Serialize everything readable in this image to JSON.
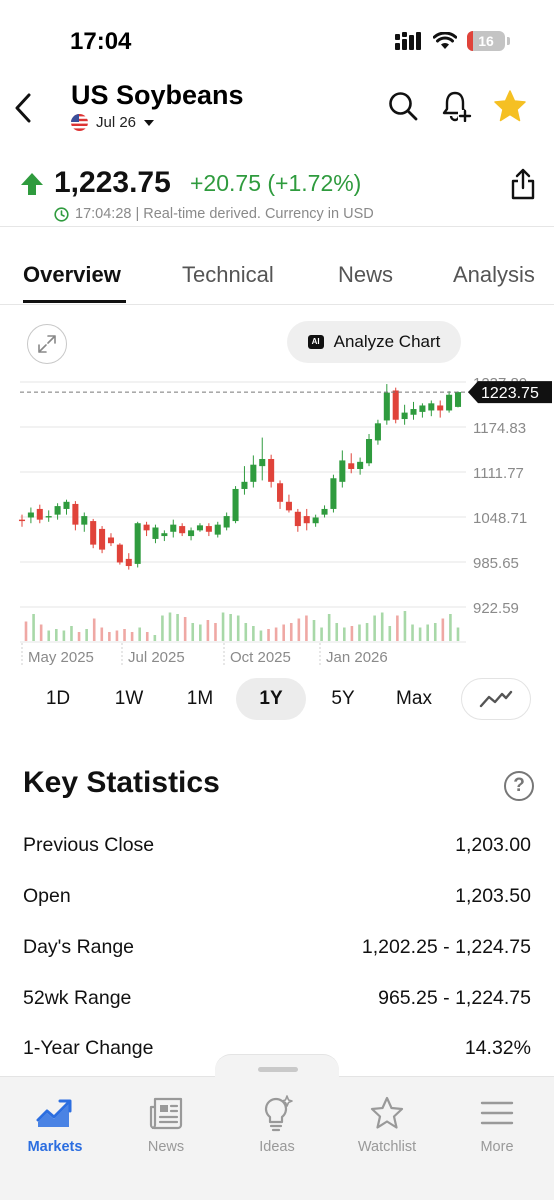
{
  "status_bar": {
    "time": "17:04",
    "battery": "16"
  },
  "header": {
    "title": "US Soybeans",
    "contract": "Jul 26",
    "icons": [
      "back-icon",
      "search-icon",
      "bell-plus-icon",
      "star-icon"
    ]
  },
  "quote": {
    "price": "1,223.75",
    "change": "+20.75 (+1.72%)",
    "timestamp": "17:04:28 | Real-time derived. Currency in USD",
    "up_color": "#2f9b3e",
    "down_color": "#e0433a"
  },
  "tabs": [
    "Overview",
    "Technical",
    "News",
    "Analysis"
  ],
  "active_tab": "Overview",
  "chart_controls": {
    "analyze_label": "Analyze Chart",
    "ai_badge": "AI"
  },
  "chart_data": {
    "type": "candlestick",
    "x_tick_labels": [
      "May 2025",
      "Jul 2025",
      "Oct 2025",
      "Jan 2026"
    ],
    "y_tick_labels": [
      "1237.89",
      "1174.83",
      "1111.77",
      "1048.71",
      "985.65",
      "922.59"
    ],
    "ylim": [
      922.59,
      1237.89
    ],
    "last_price_label": "1223.75",
    "candles": [
      {
        "o": 1045,
        "h": 1052,
        "l": 1035,
        "c": 1043
      },
      {
        "o": 1048,
        "h": 1062,
        "l": 1040,
        "c": 1055
      },
      {
        "o": 1060,
        "h": 1066,
        "l": 1040,
        "c": 1045
      },
      {
        "o": 1048,
        "h": 1058,
        "l": 1042,
        "c": 1050
      },
      {
        "o": 1052,
        "h": 1068,
        "l": 1045,
        "c": 1064
      },
      {
        "o": 1060,
        "h": 1073,
        "l": 1052,
        "c": 1070
      },
      {
        "o": 1067,
        "h": 1071,
        "l": 1030,
        "c": 1038
      },
      {
        "o": 1038,
        "h": 1055,
        "l": 1028,
        "c": 1050
      },
      {
        "o": 1043,
        "h": 1046,
        "l": 1005,
        "c": 1010
      },
      {
        "o": 1032,
        "h": 1036,
        "l": 998,
        "c": 1003
      },
      {
        "o": 1020,
        "h": 1026,
        "l": 1008,
        "c": 1012
      },
      {
        "o": 1010,
        "h": 1012,
        "l": 982,
        "c": 985
      },
      {
        "o": 990,
        "h": 998,
        "l": 975,
        "c": 980
      },
      {
        "o": 983,
        "h": 1042,
        "l": 978,
        "c": 1040
      },
      {
        "o": 1038,
        "h": 1042,
        "l": 1022,
        "c": 1030
      },
      {
        "o": 1018,
        "h": 1038,
        "l": 1012,
        "c": 1034
      },
      {
        "o": 1022,
        "h": 1030,
        "l": 1015,
        "c": 1026
      },
      {
        "o": 1028,
        "h": 1045,
        "l": 1020,
        "c": 1038
      },
      {
        "o": 1036,
        "h": 1040,
        "l": 1022,
        "c": 1026
      },
      {
        "o": 1022,
        "h": 1034,
        "l": 1016,
        "c": 1030
      },
      {
        "o": 1030,
        "h": 1040,
        "l": 1028,
        "c": 1037
      },
      {
        "o": 1036,
        "h": 1040,
        "l": 1022,
        "c": 1028
      },
      {
        "o": 1024,
        "h": 1042,
        "l": 1020,
        "c": 1038
      },
      {
        "o": 1034,
        "h": 1055,
        "l": 1030,
        "c": 1050
      },
      {
        "o": 1043,
        "h": 1092,
        "l": 1040,
        "c": 1088
      },
      {
        "o": 1088,
        "h": 1120,
        "l": 1080,
        "c": 1098
      },
      {
        "o": 1098,
        "h": 1135,
        "l": 1090,
        "c": 1122
      },
      {
        "o": 1120,
        "h": 1160,
        "l": 1100,
        "c": 1130
      },
      {
        "o": 1130,
        "h": 1136,
        "l": 1090,
        "c": 1098
      },
      {
        "o": 1096,
        "h": 1100,
        "l": 1060,
        "c": 1070
      },
      {
        "o": 1070,
        "h": 1080,
        "l": 1055,
        "c": 1058
      },
      {
        "o": 1056,
        "h": 1060,
        "l": 1028,
        "c": 1036
      },
      {
        "o": 1050,
        "h": 1060,
        "l": 1030,
        "c": 1040
      },
      {
        "o": 1040,
        "h": 1052,
        "l": 1035,
        "c": 1048
      },
      {
        "o": 1052,
        "h": 1065,
        "l": 1048,
        "c": 1060
      },
      {
        "o": 1060,
        "h": 1108,
        "l": 1055,
        "c": 1103
      },
      {
        "o": 1098,
        "h": 1142,
        "l": 1090,
        "c": 1128
      },
      {
        "o": 1124,
        "h": 1138,
        "l": 1110,
        "c": 1116
      },
      {
        "o": 1116,
        "h": 1132,
        "l": 1108,
        "c": 1126
      },
      {
        "o": 1124,
        "h": 1165,
        "l": 1120,
        "c": 1158
      },
      {
        "o": 1156,
        "h": 1185,
        "l": 1150,
        "c": 1180
      },
      {
        "o": 1184,
        "h": 1235,
        "l": 1178,
        "c": 1223
      },
      {
        "o": 1226,
        "h": 1230,
        "l": 1180,
        "c": 1185
      },
      {
        "o": 1186,
        "h": 1206,
        "l": 1178,
        "c": 1195
      },
      {
        "o": 1192,
        "h": 1210,
        "l": 1185,
        "c": 1200
      },
      {
        "o": 1196,
        "h": 1208,
        "l": 1188,
        "c": 1205
      },
      {
        "o": 1198,
        "h": 1212,
        "l": 1190,
        "c": 1208
      },
      {
        "o": 1205,
        "h": 1212,
        "l": 1188,
        "c": 1198
      },
      {
        "o": 1198,
        "h": 1225,
        "l": 1195,
        "c": 1220
      },
      {
        "o": 1203,
        "h": 1224.75,
        "l": 1202.25,
        "c": 1223.75
      }
    ],
    "volume": [
      0.65,
      0.9,
      0.55,
      0.35,
      0.4,
      0.35,
      0.5,
      0.3,
      0.4,
      0.75,
      0.45,
      0.3,
      0.35,
      0.4,
      0.3,
      0.45,
      0.3,
      0.2,
      0.85,
      0.95,
      0.9,
      0.8,
      0.6,
      0.55,
      0.7,
      0.6,
      0.95,
      0.9,
      0.85,
      0.6,
      0.5,
      0.35,
      0.4,
      0.45,
      0.55,
      0.6,
      0.75,
      0.85,
      0.7,
      0.45,
      0.9,
      0.6,
      0.45,
      0.5,
      0.55,
      0.6,
      0.85,
      0.95,
      0.5,
      0.85,
      1.0,
      0.55,
      0.45,
      0.55,
      0.6,
      0.75,
      0.9,
      0.45
    ]
  },
  "ranges": [
    "1D",
    "1W",
    "1M",
    "1Y",
    "5Y",
    "Max"
  ],
  "active_range": "1Y",
  "key_statistics": {
    "title": "Key Statistics",
    "help": "?",
    "rows": [
      {
        "label": "Previous Close",
        "value": "1,203.00"
      },
      {
        "label": "Open",
        "value": "1,203.50"
      },
      {
        "label": "Day's Range",
        "value": "1,202.25 - 1,224.75"
      },
      {
        "label": "52wk Range",
        "value": "965.25 - 1,224.75"
      },
      {
        "label": "1-Year Change",
        "value": "14.32%"
      }
    ]
  },
  "bottom_nav": {
    "items": [
      {
        "label": "Markets",
        "icon": "trending-chart-icon"
      },
      {
        "label": "News",
        "icon": "newspaper-icon"
      },
      {
        "label": "Ideas",
        "icon": "lightbulb-icon"
      },
      {
        "label": "Watchlist",
        "icon": "star-outline-icon"
      },
      {
        "label": "More",
        "icon": "menu-icon"
      }
    ],
    "active": "Markets",
    "active_color": "#2c6ee0"
  }
}
